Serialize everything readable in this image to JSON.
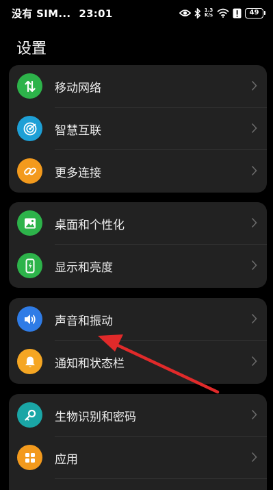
{
  "status_bar": {
    "carrier": "没有 SIM...",
    "time": "23:01",
    "net_speed_value": "1.3",
    "net_speed_unit": "K/s",
    "battery": "49"
  },
  "title": "设置",
  "groups": [
    {
      "items": [
        {
          "label": "移动网络",
          "icon": "mobile-data-icon",
          "color": "#2db34a"
        },
        {
          "label": "智慧互联",
          "icon": "smart-connect-icon",
          "color": "#1ea0d6"
        },
        {
          "label": "更多连接",
          "icon": "link-icon",
          "color": "#f39a1d"
        }
      ]
    },
    {
      "items": [
        {
          "label": "桌面和个性化",
          "icon": "wallpaper-icon",
          "color": "#2db34a"
        },
        {
          "label": "显示和亮度",
          "icon": "display-icon",
          "color": "#2db34a"
        }
      ]
    },
    {
      "items": [
        {
          "label": "声音和振动",
          "icon": "speaker-icon",
          "color": "#2f7ce6"
        },
        {
          "label": "通知和状态栏",
          "icon": "bell-icon",
          "color": "#f5a623"
        }
      ]
    },
    {
      "items": [
        {
          "label": "生物识别和密码",
          "icon": "key-icon",
          "color": "#1aa6a6"
        },
        {
          "label": "应用",
          "icon": "apps-icon",
          "color": "#f39a1d"
        }
      ]
    }
  ],
  "colors": {
    "background": "#000000",
    "card": "#222222",
    "annotation_arrow": "#e02a2a"
  }
}
